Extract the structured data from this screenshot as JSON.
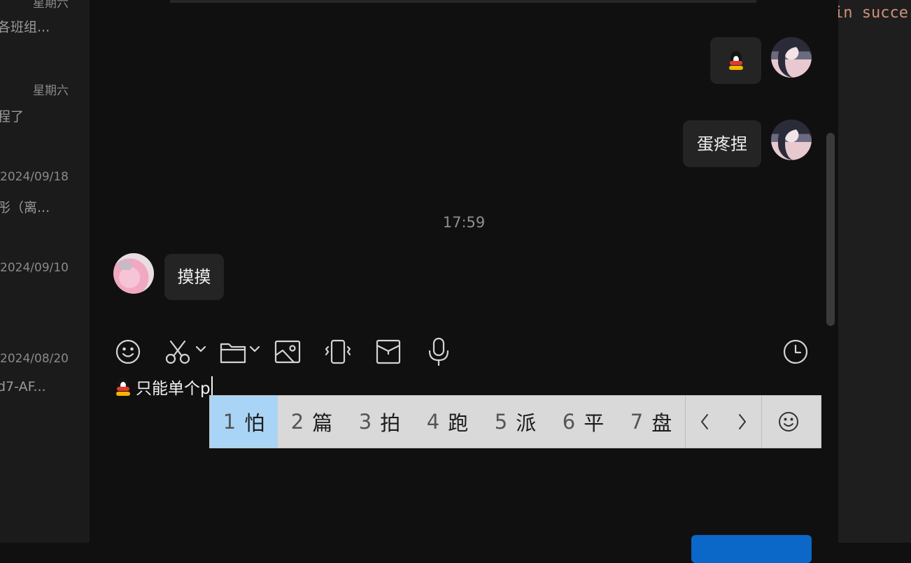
{
  "sidebar": {
    "conversations": [
      {
        "date": "星期六",
        "snippet": "各班组..."
      },
      {
        "date": "星期六",
        "snippet": "程了"
      },
      {
        "date": "2024/09/18",
        "snippet": "彤（离..."
      },
      {
        "date": "2024/09/10",
        "snippet": ""
      },
      {
        "date": "2024/08/20",
        "snippet": "d7-AF..."
      }
    ]
  },
  "chat": {
    "messages": [
      {
        "sender": "self",
        "type": "emoji",
        "emoji": "qq-penguin-icon"
      },
      {
        "sender": "self",
        "type": "text",
        "text": "蛋疼捏"
      },
      {
        "sender": "other",
        "type": "text",
        "text": "摸摸"
      }
    ],
    "timestamp": "17:59"
  },
  "toolbar": {
    "items": [
      "emoji-icon",
      "screenshot-scissors-icon",
      "folder-icon",
      "image-icon",
      "shake-icon",
      "red-packet-icon",
      "microphone-icon",
      "history-clock-icon"
    ]
  },
  "composer": {
    "text": "只能单个p"
  },
  "ime": {
    "candidates": [
      {
        "num": "1",
        "char": "怕"
      },
      {
        "num": "2",
        "char": "篇"
      },
      {
        "num": "3",
        "char": "拍"
      },
      {
        "num": "4",
        "char": "跑"
      },
      {
        "num": "5",
        "char": "派"
      },
      {
        "num": "6",
        "char": "平"
      },
      {
        "num": "7",
        "char": "盘"
      }
    ],
    "selected_index": 0
  },
  "editor": {
    "code_fragment": "in succe"
  },
  "colors": {
    "accent": "#0b67c8",
    "ime_selected": "#a9d4f5",
    "bubble": "#242424"
  }
}
